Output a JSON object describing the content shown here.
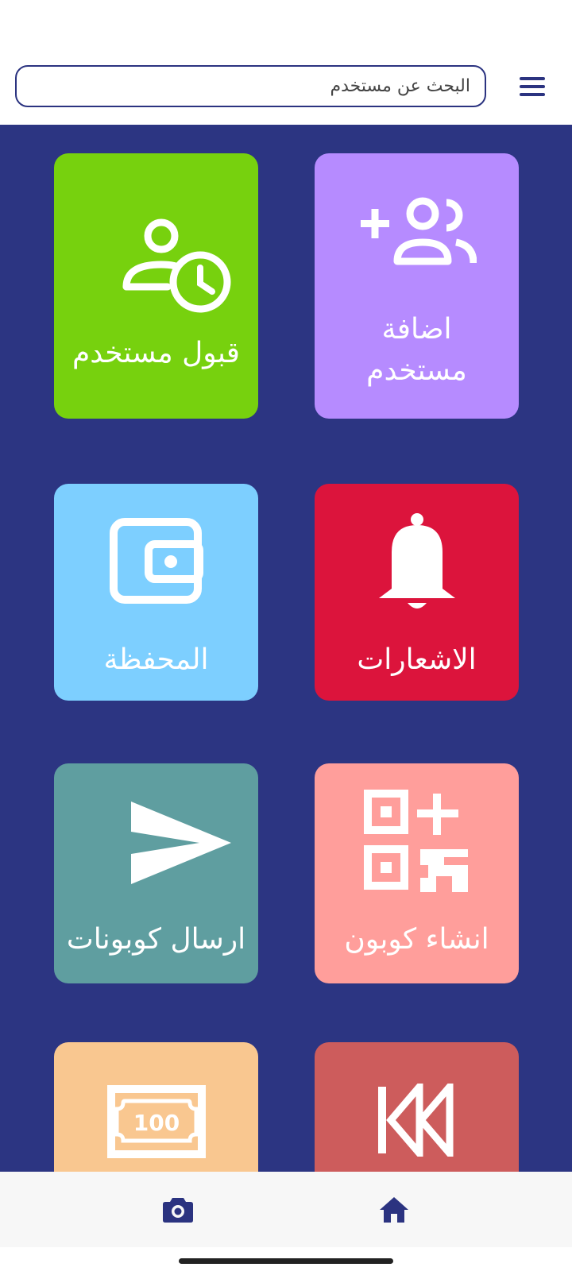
{
  "search": {
    "placeholder": "البحث عن مستخدم"
  },
  "colors": {
    "primary": "#2c3582",
    "add_user": "#b68bff",
    "accept_user": "#77d10e",
    "notifications": "#dc143c",
    "wallet": "#7dcfff",
    "create_coupon": "#ff9e9b",
    "send_coupons": "#5f9ea0",
    "rewind": "#cd5c5c",
    "money": "#f9c790"
  },
  "tiles": [
    {
      "id": "add-user",
      "label": "اضافة مستخدم",
      "icon": "add-user-icon"
    },
    {
      "id": "accept-user",
      "label": "قبول مستخدم",
      "icon": "user-clock-icon"
    },
    {
      "id": "notifications",
      "label": "الاشعارات",
      "icon": "bell-icon"
    },
    {
      "id": "wallet",
      "label": "المحفظة",
      "icon": "wallet-icon"
    },
    {
      "id": "create-coupon",
      "label": "انشاء كوبون",
      "icon": "qr-add-icon"
    },
    {
      "id": "send-coupons",
      "label": "ارسال كوبونات",
      "icon": "send-icon"
    },
    {
      "id": "rewind",
      "label": "",
      "icon": "rewind-icon"
    },
    {
      "id": "money",
      "label": "",
      "icon": "banknote-100-icon",
      "icon_text": "100"
    }
  ],
  "bottom_nav": [
    {
      "id": "home",
      "icon": "home-icon"
    },
    {
      "id": "camera",
      "icon": "camera-icon"
    }
  ]
}
